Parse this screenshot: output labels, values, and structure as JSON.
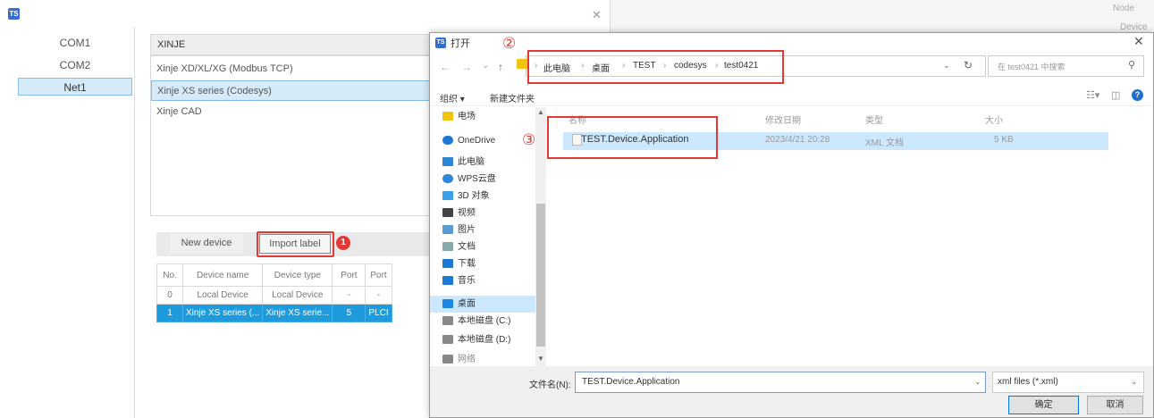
{
  "app": {
    "logo": "TS",
    "close": "✕",
    "right_label_1": "Node",
    "right_label_2": "Device"
  },
  "ports": [
    "COM1",
    "COM2",
    "Net1"
  ],
  "brand": "XINJE",
  "device_models": [
    "Xinje XD/XL/XG (Modbus TCP)",
    "Xinje XS series (Codesys)",
    "Xinje CAD"
  ],
  "buttons": {
    "new_device": "New device",
    "import_label": "Import label"
  },
  "badge_1": "1",
  "device_table": {
    "headers": [
      "No.",
      "Device name",
      "Device type",
      "Port",
      "Port"
    ],
    "rows": [
      [
        "0",
        "Local Device",
        "Local Device",
        "-",
        "-"
      ],
      [
        "1",
        "Xinje XS series (...",
        "Xinje XS serie...",
        "5",
        "PLCI"
      ]
    ]
  },
  "dialog": {
    "icon": "TS",
    "title": "打开",
    "close": "✕",
    "nav": {
      "back": "←",
      "forward": "→",
      "down": "⌄",
      "up": "↑"
    },
    "breadcrumbs": [
      "此电脑",
      "桌面",
      "TEST",
      "codesys",
      "test0421"
    ],
    "crumb_sep": "›",
    "search_placeholder": "在 test0421 中搜索",
    "toolbar": {
      "organize": "组织 ▾",
      "new_folder": "新建文件夹"
    },
    "nav_items": [
      {
        "label": "电场",
        "icon": "folder-icon",
        "color": "#f1c40f"
      },
      {
        "label": "OneDrive",
        "icon": "cloud-icon",
        "color": "#1e78d7"
      },
      {
        "label": "此电脑",
        "icon": "computer-icon",
        "color": "#2f86d6"
      },
      {
        "label": "WPS云盘",
        "icon": "cloud-icon",
        "color": "#2f86d6"
      },
      {
        "label": "3D 对象",
        "icon": "cube-icon",
        "color": "#3aa0e8"
      },
      {
        "label": "视频",
        "icon": "video-icon",
        "color": "#444"
      },
      {
        "label": "图片",
        "icon": "picture-icon",
        "color": "#5b9bd5"
      },
      {
        "label": "文档",
        "icon": "document-icon",
        "color": "#8aa"
      },
      {
        "label": "下载",
        "icon": "download-icon",
        "color": "#1e78d7"
      },
      {
        "label": "音乐",
        "icon": "music-icon",
        "color": "#1e78d7"
      },
      {
        "label": "桌面",
        "icon": "desktop-icon",
        "color": "#1e88e5"
      },
      {
        "label": "本地磁盘 (C:)",
        "icon": "drive-icon",
        "color": "#888"
      },
      {
        "label": "本地磁盘 (D:)",
        "icon": "drive-icon",
        "color": "#888"
      },
      {
        "label": "网络",
        "icon": "network-icon",
        "color": "#888"
      }
    ],
    "columns": [
      "名称",
      "修改日期",
      "类型",
      "大小"
    ],
    "file": {
      "name": "TEST.Device.Application",
      "date": "2023/4/21 20:28",
      "type": "XML 文档",
      "size": "5 KB"
    },
    "filename_label": "文件名(N):",
    "filename_value": "TEST.Device.Application",
    "filter": "xml files (*.xml)",
    "ok": "确定",
    "cancel": "取消"
  },
  "markers": {
    "m2": "②",
    "m3": "③"
  },
  "colors": {
    "highlight_red": "#e53935",
    "selection_blue": "#1e9bdc",
    "folder_yellow": "#f1c40f"
  }
}
